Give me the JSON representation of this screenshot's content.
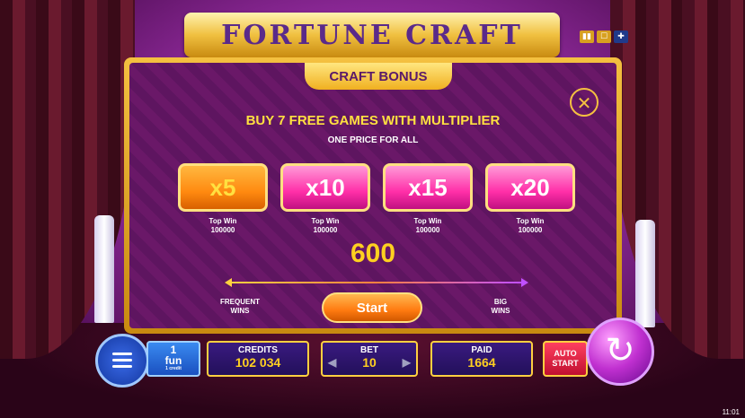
{
  "game": {
    "title": "FORTUNE CRAFT"
  },
  "top_icons": [
    {
      "icon": "pause-icon"
    },
    {
      "icon": "info-icon"
    },
    {
      "icon": "uk-flag-icon"
    }
  ],
  "dialog": {
    "tab_title": "CRAFT BONUS",
    "close_glyph": "✕",
    "headline": "BUY 7 FREE GAMES WITH MULTIPLIER",
    "subheadline": "ONE PRICE FOR ALL",
    "multipliers": [
      {
        "label": "x5",
        "top_win_label": "Top Win",
        "top_win_value": "100000",
        "selected": true
      },
      {
        "label": "x10",
        "top_win_label": "Top Win",
        "top_win_value": "100000",
        "selected": false
      },
      {
        "label": "x15",
        "top_win_label": "Top Win",
        "top_win_value": "100000",
        "selected": false
      },
      {
        "label": "x20",
        "top_win_label": "Top Win",
        "top_win_value": "100000",
        "selected": false
      }
    ],
    "price": "600",
    "left_label_1": "FREQUENT",
    "left_label_2": "WINS",
    "right_label_1": "BIG",
    "right_label_2": "WINS",
    "start_label": "Start"
  },
  "hud": {
    "fun_count": "1",
    "fun_label": "fun",
    "fun_sub": "1 credit",
    "credits_label": "CREDITS",
    "credits_value": "102 034",
    "bet_label": "BET",
    "bet_value": "10",
    "paid_label": "PAID",
    "paid_value": "1664",
    "auto_label_1": "AUTO",
    "auto_label_2": "START",
    "spin_glyph": "↻",
    "clock": "11:01"
  },
  "colors": {
    "gold": "#ffd020",
    "selected_multiplier": "#ff8a10",
    "multiplier": "#ff2fa8",
    "panel": "#6a1868"
  }
}
